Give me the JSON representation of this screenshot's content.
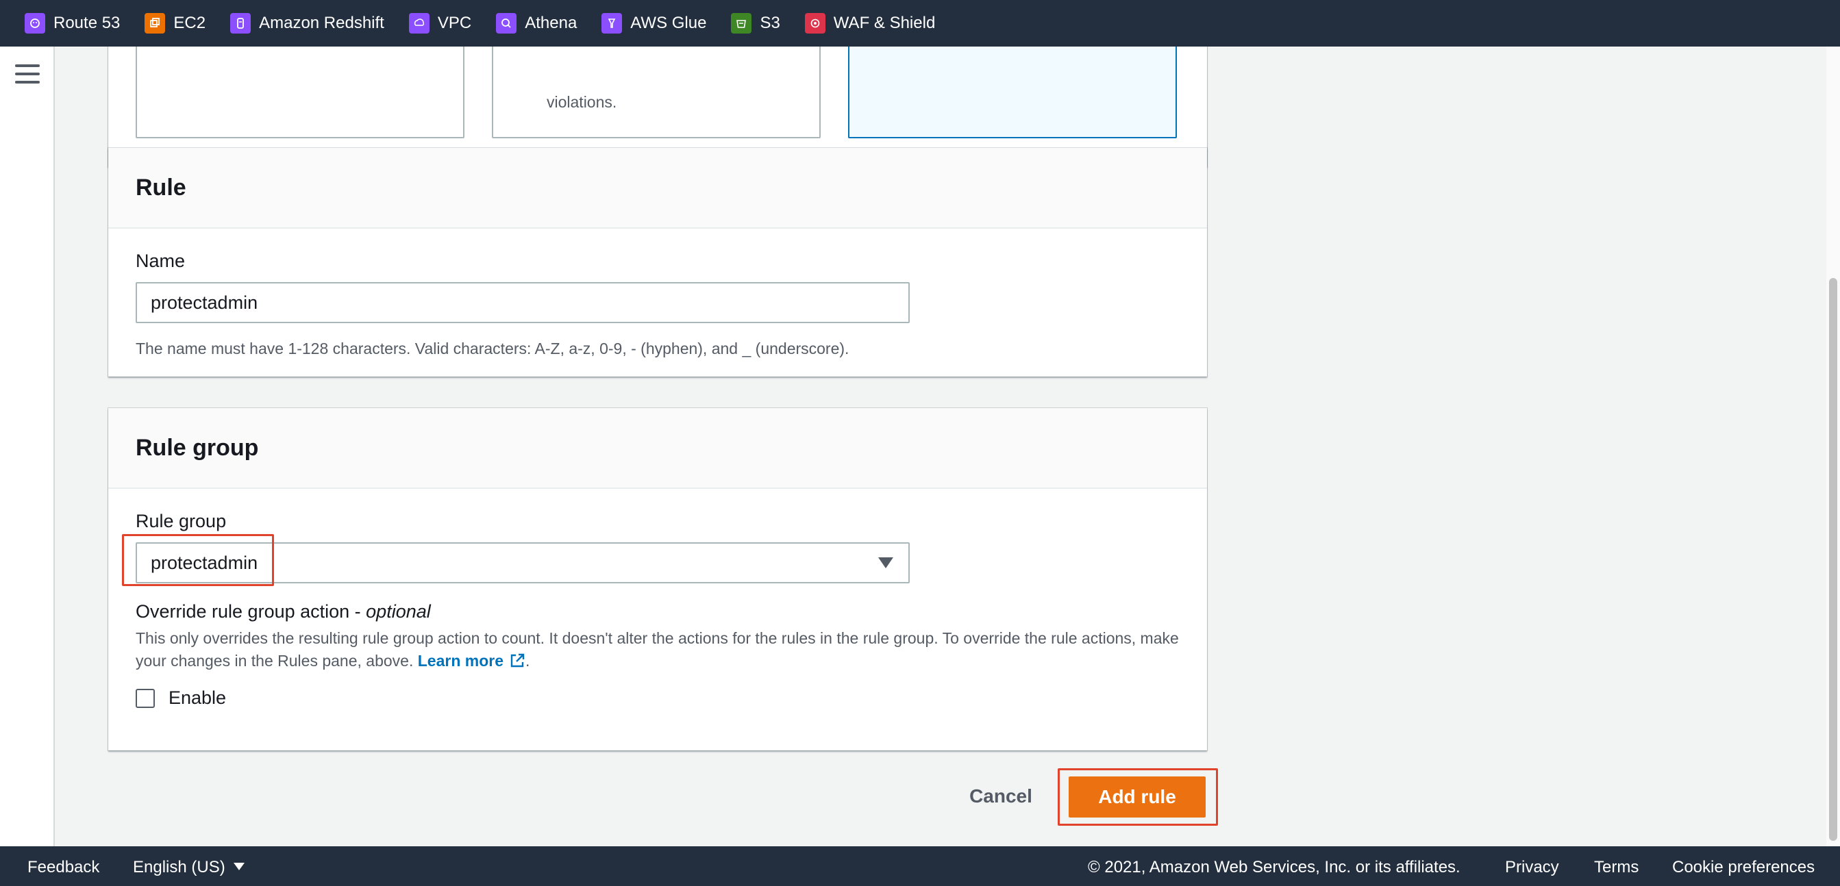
{
  "topbar": {
    "favorites": [
      {
        "label": "Route 53",
        "icon": "route53-icon",
        "color": "#8c4fff"
      },
      {
        "label": "EC2",
        "icon": "ec2-icon",
        "color": "#ed7100"
      },
      {
        "label": "Amazon Redshift",
        "icon": "redshift-icon",
        "color": "#8c4fff"
      },
      {
        "label": "VPC",
        "icon": "vpc-icon",
        "color": "#8c4fff"
      },
      {
        "label": "Athena",
        "icon": "athena-icon",
        "color": "#8c4fff"
      },
      {
        "label": "AWS Glue",
        "icon": "glue-icon",
        "color": "#8c4fff"
      },
      {
        "label": "S3",
        "icon": "s3-icon",
        "color": "#3f8624"
      },
      {
        "label": "WAF & Shield",
        "icon": "waf-icon",
        "color": "#dd344c"
      }
    ]
  },
  "top_panel": {
    "tile_text": "violations."
  },
  "rule_panel": {
    "title": "Rule",
    "name_label": "Name",
    "name_value": "protectadmin",
    "name_hint": "The name must have 1-128 characters. Valid characters: A-Z, a-z, 0-9, - (hyphen), and _ (underscore)."
  },
  "rule_group_panel": {
    "title": "Rule group",
    "select_label": "Rule group",
    "selected_value": "protectadmin",
    "override_label": "Override rule group action - ",
    "override_optional": "optional",
    "override_desc": "This only overrides the resulting rule group action to count. It doesn't alter the actions for the rules in the rule group. To override the rule actions, make your changes in the Rules pane, above.",
    "learn_more": "Learn more",
    "period": ".",
    "enable_label": "Enable"
  },
  "actions": {
    "cancel_label": "Cancel",
    "add_label": "Add rule"
  },
  "footer": {
    "feedback": "Feedback",
    "language": "English (US)",
    "copyright": "© 2021, Amazon Web Services, Inc. or its affiliates.",
    "privacy": "Privacy",
    "terms": "Terms",
    "cookies": "Cookie preferences"
  },
  "colors": {
    "topbar_bg": "#232f3e",
    "primary_button": "#ec7211",
    "highlight": "#e0442c",
    "link": "#0073bb"
  }
}
